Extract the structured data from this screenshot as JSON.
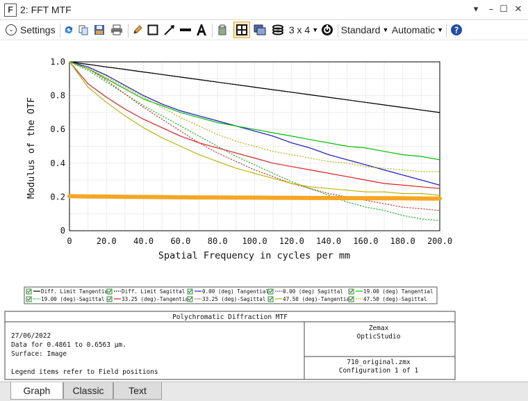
{
  "window": {
    "title": "2: FFT MTF",
    "app_icon": "F",
    "controls": [
      "chevron-down-icon",
      "minimize-icon",
      "maximize-icon",
      "close-icon"
    ]
  },
  "toolbar": {
    "settings_label": "Settings",
    "layout_label": "3 x 4",
    "standard_label": "Standard",
    "automatic_label": "Automatic",
    "icons": [
      "refresh-icon",
      "copy-icon",
      "save-icon",
      "print-icon",
      "pencil-icon",
      "rectangle-icon",
      "arrow-icon",
      "line-icon",
      "text-icon",
      "clipboard-icon",
      "window-icon",
      "layers-icon",
      "stack-icon",
      "dial-icon",
      "help-icon"
    ]
  },
  "chart_data": {
    "type": "line",
    "title": "",
    "xlabel": "Spatial Frequency in cycles per mm",
    "ylabel": "Modulus of the OTF",
    "xlim": [
      0,
      200
    ],
    "ylim": [
      0,
      1.0
    ],
    "xticks": [
      "0",
      "20.0",
      "40.0",
      "60.0",
      "80.0",
      "100.0",
      "120.0",
      "140.0",
      "160.0",
      "180.0",
      "200.0"
    ],
    "yticks": [
      "0",
      "0.2",
      "0.4",
      "0.6",
      "0.8",
      "1.0"
    ],
    "grid": true,
    "x": [
      0,
      10,
      20,
      30,
      40,
      50,
      60,
      70,
      80,
      90,
      100,
      110,
      120,
      130,
      140,
      150,
      160,
      170,
      180,
      190,
      200
    ],
    "series": [
      {
        "name": "Diff. Limit Tangential",
        "color": "#000000",
        "dash": "solid",
        "values": [
          1.0,
          0.985,
          0.97,
          0.955,
          0.94,
          0.925,
          0.91,
          0.895,
          0.88,
          0.865,
          0.85,
          0.835,
          0.82,
          0.805,
          0.79,
          0.775,
          0.76,
          0.745,
          0.73,
          0.715,
          0.7
        ]
      },
      {
        "name": "Diff. Limit Sagittal",
        "color": "#000000",
        "dash": "dotted",
        "values": [
          1.0,
          0.985,
          0.97,
          0.955,
          0.94,
          0.925,
          0.91,
          0.895,
          0.88,
          0.865,
          0.85,
          0.835,
          0.82,
          0.805,
          0.79,
          0.775,
          0.76,
          0.745,
          0.73,
          0.715,
          0.7
        ]
      },
      {
        "name": "0.00 (deg) Tangential",
        "color": "#2020d0",
        "dash": "solid",
        "values": [
          1.0,
          0.97,
          0.92,
          0.86,
          0.8,
          0.75,
          0.71,
          0.68,
          0.65,
          0.62,
          0.59,
          0.56,
          0.52,
          0.49,
          0.45,
          0.42,
          0.39,
          0.36,
          0.33,
          0.3,
          0.27
        ]
      },
      {
        "name": "0.00 (deg) Sagittal",
        "color": "#2020d0",
        "dash": "dotted",
        "values": [
          1.0,
          0.97,
          0.92,
          0.86,
          0.8,
          0.75,
          0.71,
          0.68,
          0.65,
          0.62,
          0.59,
          0.56,
          0.52,
          0.49,
          0.45,
          0.42,
          0.39,
          0.36,
          0.33,
          0.3,
          0.27
        ]
      },
      {
        "name": "19.00 (deg) Tangential",
        "color": "#00c000",
        "dash": "solid",
        "values": [
          1.0,
          0.96,
          0.9,
          0.84,
          0.78,
          0.74,
          0.7,
          0.67,
          0.64,
          0.62,
          0.6,
          0.58,
          0.56,
          0.54,
          0.52,
          0.5,
          0.49,
          0.47,
          0.45,
          0.44,
          0.42
        ]
      },
      {
        "name": "19.00 (deg)-Sagittal",
        "color": "#00c000",
        "dash": "dotted",
        "values": [
          1.0,
          0.95,
          0.88,
          0.81,
          0.74,
          0.68,
          0.62,
          0.56,
          0.5,
          0.44,
          0.39,
          0.34,
          0.29,
          0.25,
          0.21,
          0.17,
          0.14,
          0.12,
          0.09,
          0.07,
          0.06
        ]
      },
      {
        "name": "33.25 (deg)-Tangential",
        "color": "#e02020",
        "dash": "solid",
        "values": [
          1.0,
          0.87,
          0.79,
          0.72,
          0.66,
          0.61,
          0.56,
          0.52,
          0.49,
          0.46,
          0.43,
          0.4,
          0.38,
          0.36,
          0.34,
          0.32,
          0.3,
          0.28,
          0.27,
          0.26,
          0.25
        ]
      },
      {
        "name": "33.25 (deg)-Sagittal",
        "color": "#e02020",
        "dash": "dotted",
        "values": [
          1.0,
          0.96,
          0.89,
          0.81,
          0.73,
          0.66,
          0.59,
          0.52,
          0.46,
          0.41,
          0.36,
          0.32,
          0.28,
          0.25,
          0.22,
          0.2,
          0.18,
          0.16,
          0.14,
          0.13,
          0.12
        ]
      },
      {
        "name": "47.50 (deg)-Tangential",
        "color": "#b8b800",
        "dash": "solid",
        "values": [
          1.0,
          0.85,
          0.76,
          0.68,
          0.61,
          0.55,
          0.5,
          0.45,
          0.41,
          0.37,
          0.34,
          0.31,
          0.28,
          0.26,
          0.25,
          0.24,
          0.23,
          0.23,
          0.22,
          0.22,
          0.21
        ]
      },
      {
        "name": "47.50 (deg)-Sagittal",
        "color": "#b8b800",
        "dash": "dotted",
        "values": [
          1.0,
          0.96,
          0.91,
          0.85,
          0.79,
          0.73,
          0.67,
          0.62,
          0.57,
          0.53,
          0.5,
          0.47,
          0.45,
          0.43,
          0.41,
          0.4,
          0.38,
          0.37,
          0.36,
          0.35,
          0.35
        ]
      },
      {
        "name": "",
        "color": "#f5a623",
        "dash": "thick",
        "values": [
          0.205,
          0.203,
          0.202,
          0.201,
          0.2,
          0.199,
          0.198,
          0.197,
          0.197,
          0.196,
          0.196,
          0.195,
          0.195,
          0.194,
          0.194,
          0.193,
          0.193,
          0.192,
          0.192,
          0.191,
          0.19
        ]
      }
    ]
  },
  "info": {
    "title": "Polychromatic Diffraction MTF",
    "date": "27/06/2022",
    "data_line": "Data for 0.4861 to 0.6563 µm.",
    "surface": "Surface: Image",
    "note": "Legend items refer to Field positions",
    "company": "Zemax",
    "product": "OpticStudio",
    "file": "710_original.zmx",
    "config": "Configuration 1 of 1"
  },
  "tabs": [
    "Graph",
    "Classic",
    "Text"
  ]
}
